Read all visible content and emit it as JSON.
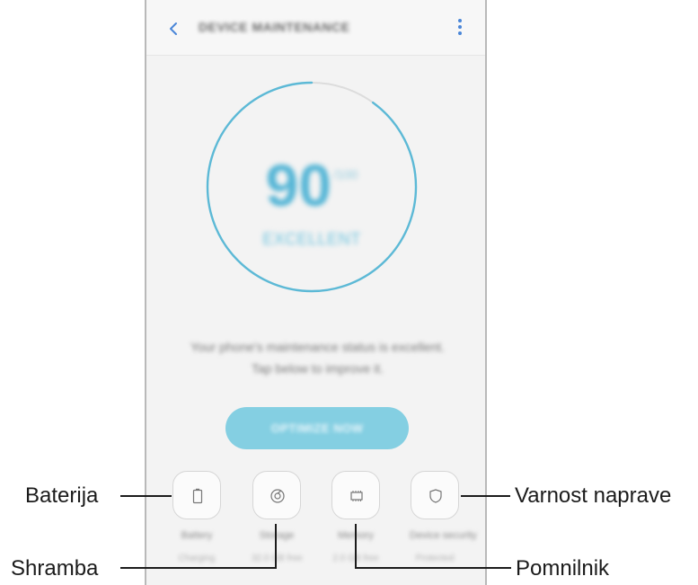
{
  "header": {
    "title": "DEVICE MAINTENANCE"
  },
  "score": {
    "value": "90",
    "max": "/100",
    "status": "EXCELLENT",
    "fraction": 0.9
  },
  "message": {
    "line1": "Your phone's maintenance status is excellent.",
    "line2": "Tap below to improve it."
  },
  "optimize_button": {
    "label": "OPTIMIZE NOW"
  },
  "categories": [
    {
      "name": "Battery",
      "value": "Charging",
      "icon": "battery-icon"
    },
    {
      "name": "Storage",
      "value": "32.0 GB free",
      "icon": "storage-icon"
    },
    {
      "name": "Memory",
      "value": "2.0 GB free",
      "icon": "memory-icon"
    },
    {
      "name": "Device security",
      "value": "Protected",
      "icon": "shield-icon"
    }
  ],
  "callouts": {
    "battery": "Baterija",
    "storage": "Shramba",
    "memory": "Pomnilnik",
    "security": "Varnost naprave"
  },
  "colors": {
    "accent": "#5cb9d6",
    "button": "#84cfe2",
    "more": "#4a86d8"
  }
}
